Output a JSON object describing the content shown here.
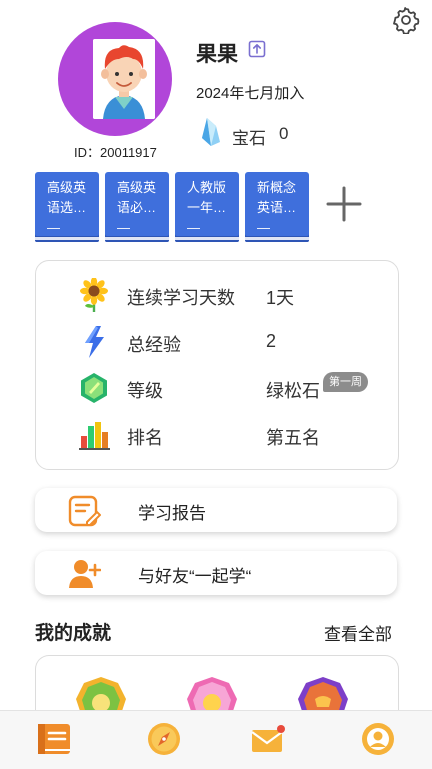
{
  "profile": {
    "username": "果果",
    "user_id": "ID：20011917",
    "join_date": "2024年七月加入",
    "gem_label": "宝石",
    "gem_count": "0"
  },
  "books": [
    {
      "title": "高级英语选…—"
    },
    {
      "title": "高级英语必…—"
    },
    {
      "title": "人教版一年…—"
    },
    {
      "title": "新概念英语…—"
    }
  ],
  "stats": [
    {
      "icon": "sunflower-icon",
      "label": "连续学习天数",
      "value": "1天"
    },
    {
      "icon": "lightning-icon",
      "label": "总经验",
      "value": "2"
    },
    {
      "icon": "gem-level-icon",
      "label": "等级",
      "value": "绿松石",
      "badge": "第一周"
    },
    {
      "icon": "bar-chart-icon",
      "label": "排名",
      "value": "第五名"
    }
  ],
  "actions": {
    "report_label": "学习报告",
    "invite_label": "与好友“一起学“"
  },
  "achievements": {
    "title": "我的成就",
    "view_all": "查看全部"
  },
  "colors": {
    "avatar_ring": "#b146d9",
    "book_blue": "#3f6fdc",
    "accent_orange": "#f08c2a",
    "badge_gray": "#8c8c8c"
  },
  "nav": [
    "book-nav-icon",
    "compass-nav-icon",
    "mail-nav-icon",
    "profile-nav-icon"
  ]
}
